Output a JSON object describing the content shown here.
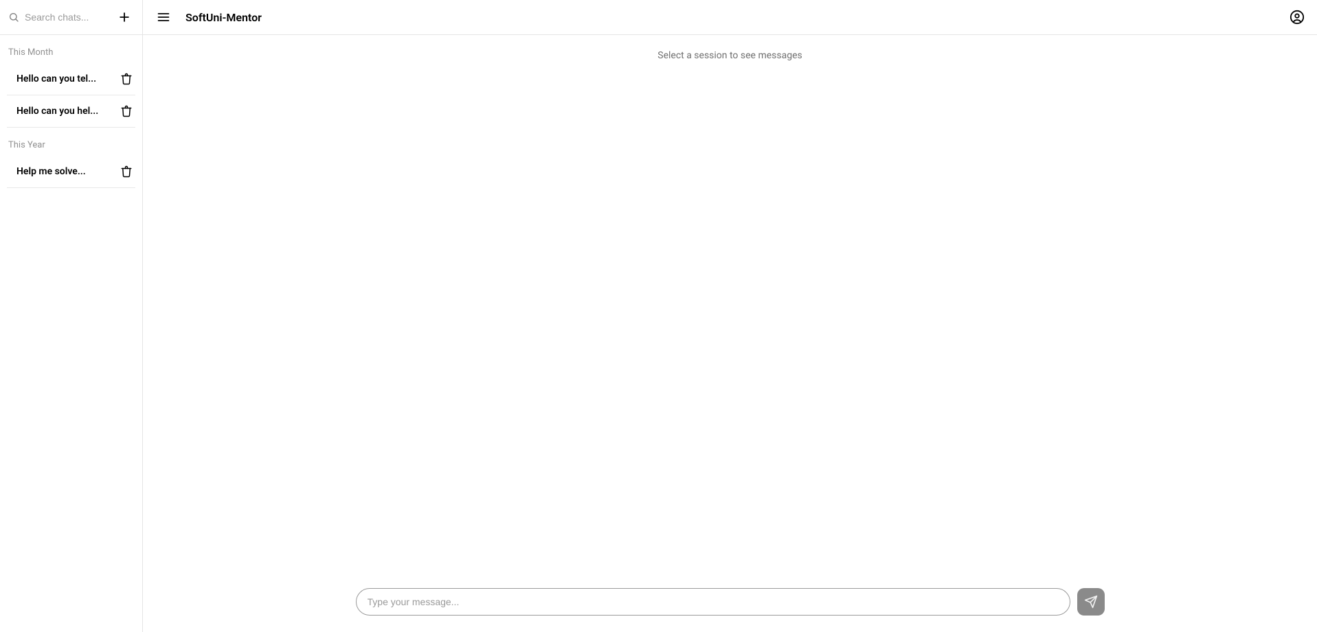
{
  "sidebar": {
    "search_placeholder": "Search chats...",
    "sections": [
      {
        "label": "This Month",
        "items": [
          {
            "title": "Hello can you tel..."
          },
          {
            "title": "Hello can you hel..."
          }
        ]
      },
      {
        "label": "This Year",
        "items": [
          {
            "title": "Help me solve..."
          }
        ]
      }
    ]
  },
  "header": {
    "title": "SoftUni-Mentor"
  },
  "main": {
    "empty_state": "Select a session to see messages"
  },
  "composer": {
    "placeholder": "Type your message..."
  }
}
